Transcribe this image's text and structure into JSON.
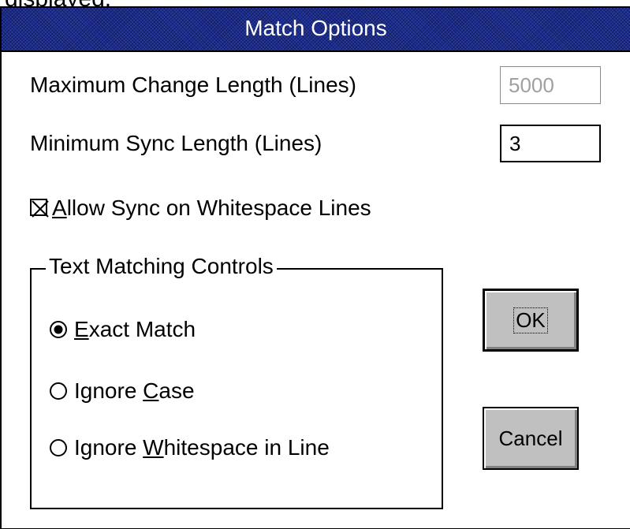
{
  "header_cutoff_text": "displayed.",
  "dialog": {
    "title": "Match Options",
    "max_change": {
      "label": "Maximum Change Length (Lines)",
      "value": "5000",
      "enabled": false
    },
    "min_sync": {
      "label": "Minimum Sync Length (Lines)",
      "value": "3",
      "enabled": true
    },
    "allow_sync": {
      "mnemonic": "A",
      "rest": "llow Sync on Whitespace Lines",
      "checked": true
    },
    "group": {
      "title": "Text Matching Controls",
      "options": [
        {
          "prefix": "",
          "mnemonic": "E",
          "rest": "xact Match",
          "selected": true
        },
        {
          "prefix": "Ignore ",
          "mnemonic": "C",
          "rest": "ase",
          "selected": false
        },
        {
          "prefix": "Ignore ",
          "mnemonic": "W",
          "rest": "hitespace in Line",
          "selected": false
        }
      ]
    },
    "buttons": {
      "ok": "OK",
      "cancel": "Cancel"
    }
  },
  "colors": {
    "titlebar": "#1a2a8a",
    "button_face": "#c0c0c0",
    "disabled_text": "#a0a0a0"
  }
}
